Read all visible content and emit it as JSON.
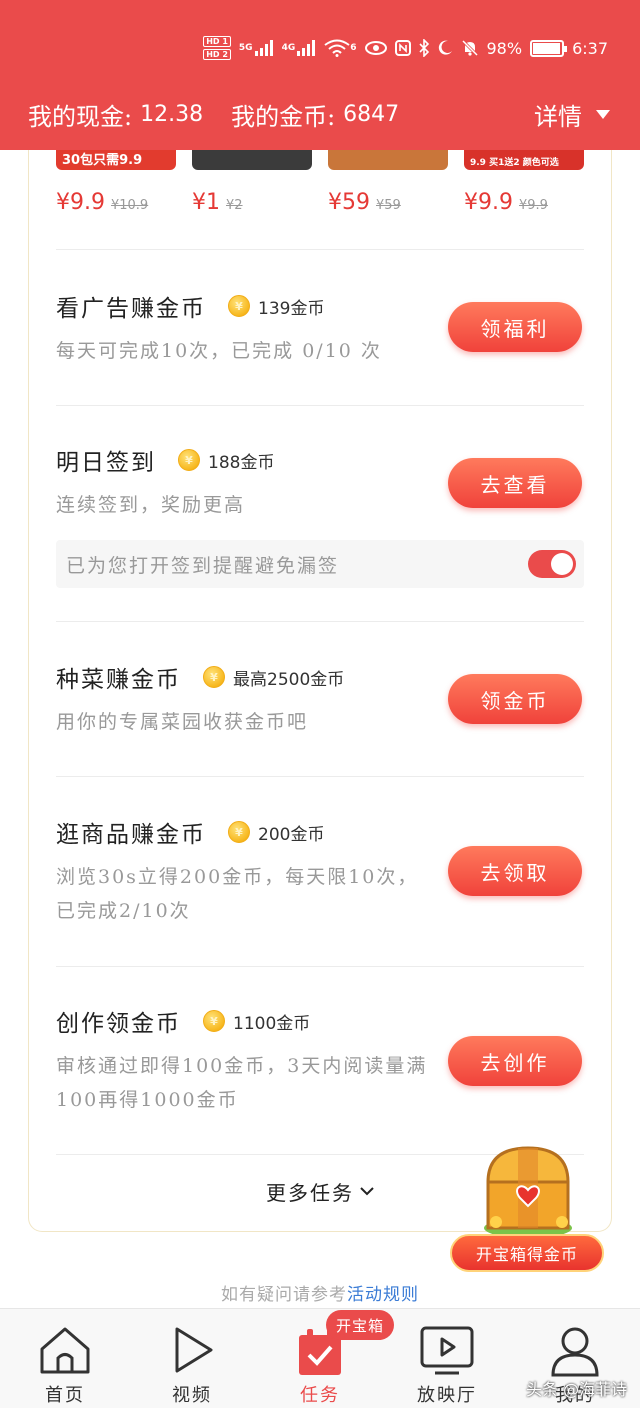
{
  "status_bar": {
    "hd1": "HD 1",
    "hd2": "HD 2",
    "net1": "5G",
    "net2": "4G",
    "wifi": "6",
    "battery_text": "98%",
    "battery_level": 0.98,
    "time": "6:37"
  },
  "header": {
    "cash_label": "我的现金:",
    "cash_value": "12.38",
    "coins_label": "我的金币:",
    "coins_value": "6847",
    "detail_label": "详情"
  },
  "products": [
    {
      "banner": "30包只需9.9",
      "price": "¥9.9",
      "old_price": "¥10.9",
      "color": "#e23b2e"
    },
    {
      "banner": "",
      "price": "¥1",
      "old_price": "¥2",
      "color": "#3b3b3b"
    },
    {
      "banner": "",
      "price": "¥59",
      "old_price": "¥59",
      "color": "#c9763a"
    },
    {
      "banner": "9.9 买1送2 颜色可选",
      "price": "¥9.9",
      "old_price": "¥9.9",
      "color": "#d8322a"
    }
  ],
  "tasks": [
    {
      "title": "看广告赚金币",
      "reward": "139金币",
      "desc": "每天可完成10次，已完成 0/10 次",
      "button": "领福利"
    },
    {
      "title": "明日签到",
      "reward": "188金币",
      "desc": "连续签到，奖励更高",
      "button": "去查看"
    },
    {
      "title": "种菜赚金币",
      "reward": "最高2500金币",
      "desc": "用你的专属菜园收获金币吧",
      "button": "领金币"
    },
    {
      "title": "逛商品赚金币",
      "reward": "200金币",
      "desc": "浏览30s立得200金币，每天限10次，已完成2/10次",
      "button": "去领取"
    },
    {
      "title": "创作领金币",
      "reward": "1100金币",
      "desc": "审核通过即得100金币，3天内阅读量满100再得1000金币",
      "button": "去创作"
    }
  ],
  "checkin_reminder": {
    "text": "已为您打开签到提醒避免漏签",
    "enabled": true
  },
  "more_tasks": "更多任务",
  "treasure_button": "开宝箱得金币",
  "rules": {
    "prefix": "如有疑问请参考",
    "link": "活动规则"
  },
  "tabbar": {
    "items": [
      {
        "label": "首页",
        "icon": "home-icon"
      },
      {
        "label": "视频",
        "icon": "play-icon"
      },
      {
        "label": "任务",
        "icon": "task-check-icon"
      },
      {
        "label": "放映厅",
        "icon": "tv-play-icon"
      },
      {
        "label": "我的",
        "icon": "user-icon"
      }
    ],
    "badge": "开宝箱",
    "active_index": 2
  },
  "watermark": "头条 @海菲诗",
  "colors": {
    "brand_red": "#ea4b4b",
    "link_blue": "#3a7bd5"
  }
}
